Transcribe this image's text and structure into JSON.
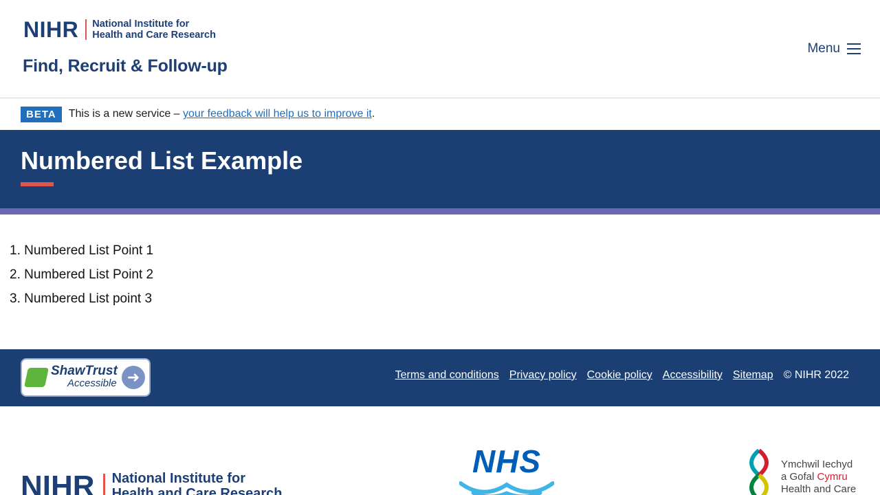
{
  "header": {
    "logo_mark": "NIHR",
    "logo_line1": "National Institute for",
    "logo_line2": "Health and Care Research",
    "service_name": "Find, Recruit & Follow-up",
    "menu_label": "Menu"
  },
  "beta": {
    "tag": "BETA",
    "text_before": "This is a new service – ",
    "link": "your feedback will help us to improve it",
    "text_after": "."
  },
  "page": {
    "title": "Numbered List Example",
    "items": [
      "1. Numbered List Point 1",
      "2. Numbered List Point 2",
      "3. Numbered List point 3"
    ]
  },
  "footer": {
    "shaw_title": "ShawTrust",
    "shaw_sub": "Accessible",
    "links": [
      "Terms and conditions",
      "Privacy policy",
      "Cookie policy",
      "Accessibility",
      "Sitemap"
    ],
    "copyright": "© NIHR 2022"
  },
  "partners": {
    "nihr_mark": "NIHR",
    "nihr_line1": "National Institute for",
    "nihr_line2": "Health and Care Research",
    "nhs": "NHS",
    "wales_line1": "Ymchwil Iechyd",
    "wales_line2a": "a Gofal ",
    "wales_line2b": "Cymru",
    "wales_line3": "Health and Care"
  },
  "colors": {
    "brand_navy": "#1b3e73",
    "accent_red": "#e0554e",
    "stripe_purple": "#6b67b5",
    "link_blue": "#1f6fbd"
  }
}
